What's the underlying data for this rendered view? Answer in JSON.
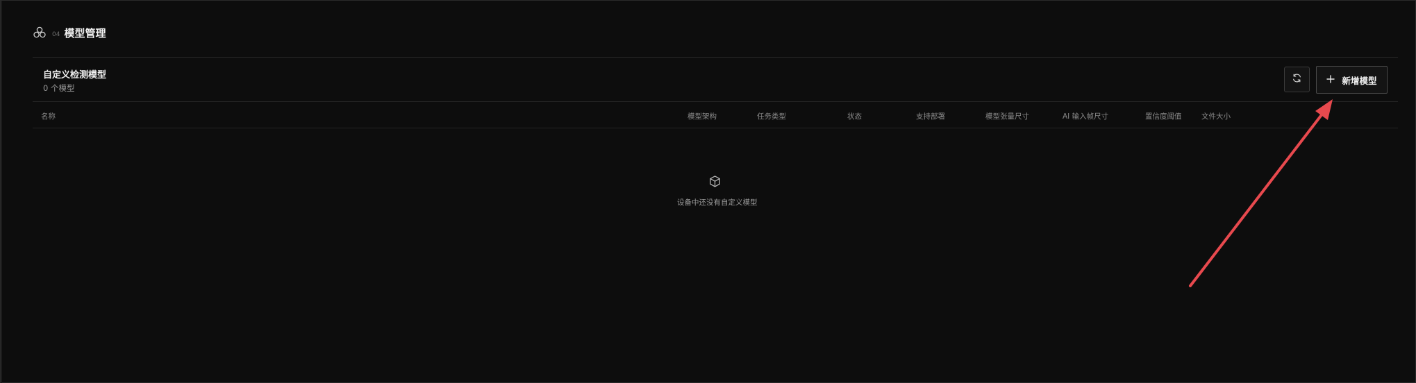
{
  "section": {
    "number": "04",
    "title": "模型管理",
    "icon": "models-cluster-icon"
  },
  "panel": {
    "title": "自定义检测模型",
    "subtitle": "0 个模型",
    "refresh_icon": "refresh-icon",
    "add_button_icon": "plus-icon",
    "add_button_label": "新增模型"
  },
  "table": {
    "headers": [
      "名称",
      "模型架构",
      "任务类型",
      "状态",
      "支持部署",
      "模型张量尺寸",
      "AI 输入帧尺寸",
      "置信度阈值",
      "文件大小"
    ],
    "rows": []
  },
  "empty_state": {
    "icon": "box-icon",
    "text": "设备中还没有自定义模型"
  },
  "colors": {
    "background": "#0d0d0d",
    "annotation_arrow": "#e8494e"
  }
}
